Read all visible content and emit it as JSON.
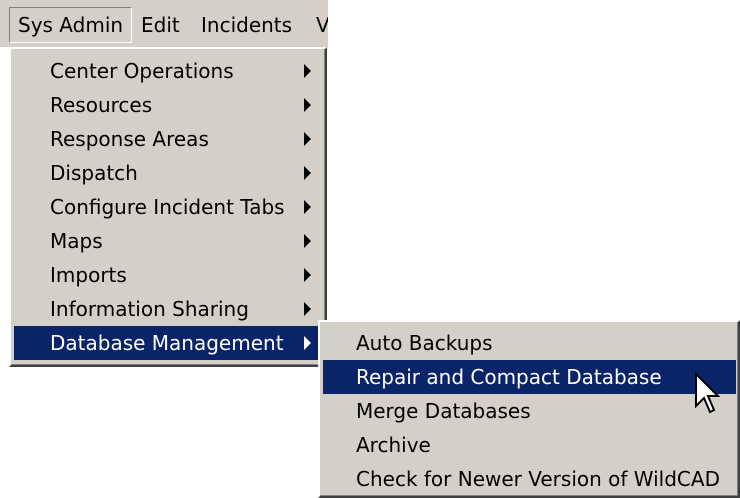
{
  "menubar": {
    "items": [
      {
        "label": "Sys Admin"
      },
      {
        "label": "Edit"
      },
      {
        "label": "Incidents"
      },
      {
        "label": "V"
      }
    ]
  },
  "sysadmin_menu": {
    "items": [
      {
        "label": "Center Operations"
      },
      {
        "label": "Resources"
      },
      {
        "label": "Response Areas"
      },
      {
        "label": "Dispatch"
      },
      {
        "label": "Configure Incident Tabs"
      },
      {
        "label": "Maps"
      },
      {
        "label": "Imports"
      },
      {
        "label": "Information Sharing"
      },
      {
        "label": "Database Management"
      }
    ],
    "highlighted": "Database Management"
  },
  "database_submenu": {
    "items": [
      {
        "label": "Auto Backups"
      },
      {
        "label": "Repair and Compact Database"
      },
      {
        "label": "Merge Databases"
      },
      {
        "label": "Archive"
      },
      {
        "label": "Check for Newer Version of WildCAD"
      }
    ],
    "highlighted": "Repair and Compact Database"
  },
  "colors": {
    "menu_bg": "#d4d0c8",
    "highlight_bg": "#0a246a",
    "highlight_text": "#ffffff"
  },
  "icons": [
    "submenu-arrow-icon",
    "mouse-pointer-icon"
  ]
}
